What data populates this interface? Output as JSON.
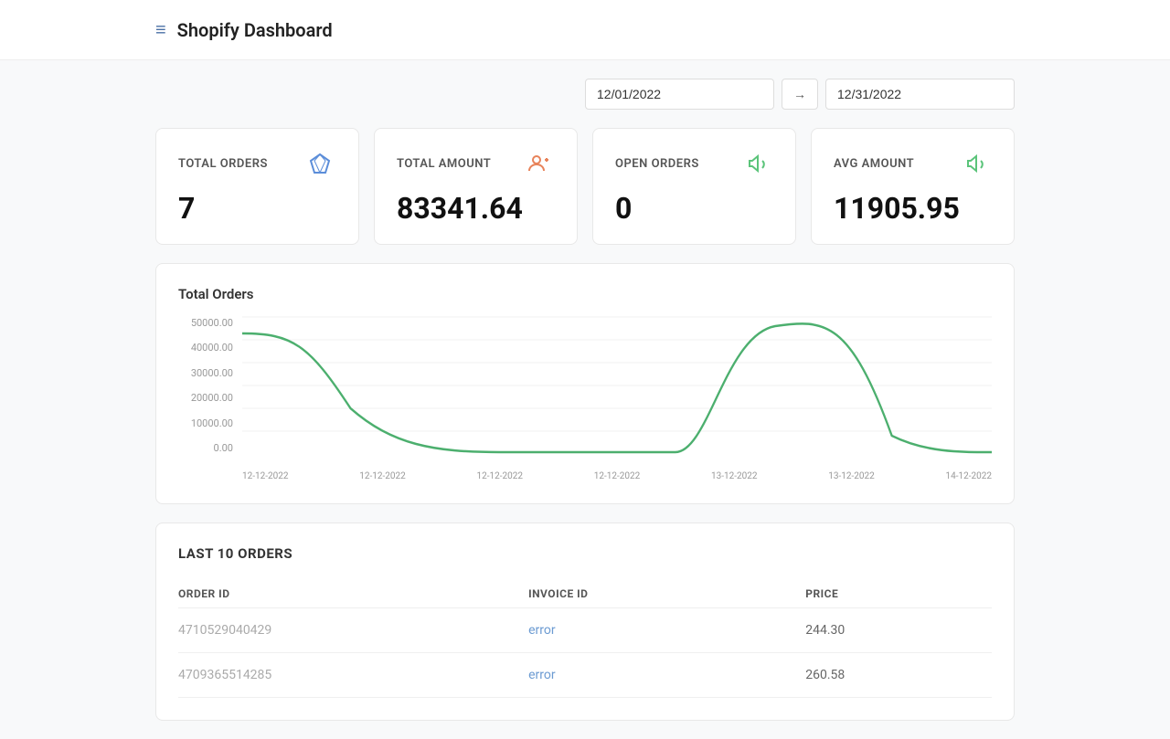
{
  "header": {
    "title": "Shopify Dashboard",
    "icon": "≡"
  },
  "dateFilter": {
    "startDate": "12/01/2022",
    "endDate": "12/31/2022",
    "arrowLabel": "→"
  },
  "stats": [
    {
      "id": "total-orders",
      "label": "TOTAL ORDERS",
      "value": "7",
      "iconName": "diamond-icon",
      "iconSymbol": "💎",
      "iconClass": "icon-diamond"
    },
    {
      "id": "total-amount",
      "label": "TOTAL AMOUNT",
      "value": "83341.64",
      "iconName": "user-add-icon",
      "iconSymbol": "👤",
      "iconClass": "icon-user-add"
    },
    {
      "id": "open-orders",
      "label": "OPEN ORDERS",
      "value": "0",
      "iconName": "megaphone-icon",
      "iconSymbol": "📣",
      "iconClass": "icon-megaphone"
    },
    {
      "id": "avg-amount",
      "label": "AVG AMOUNT",
      "value": "11905.95",
      "iconName": "megaphone2-icon",
      "iconSymbol": "📣",
      "iconClass": "icon-megaphone2"
    }
  ],
  "chart": {
    "title": "Total Orders",
    "yLabels": [
      "50000.00",
      "40000.00",
      "30000.00",
      "20000.00",
      "10000.00",
      "0.00"
    ],
    "xLabels": [
      "12-12-2022",
      "12-12-2022",
      "12-12-2022",
      "12-12-2022",
      "13-12-2022",
      "13-12-2022",
      "14-12-2022"
    ]
  },
  "ordersTable": {
    "title": "LAST 10 ORDERS",
    "columns": [
      "ORDER ID",
      "INVOICE ID",
      "PRICE"
    ],
    "rows": [
      {
        "orderId": "4710529040429",
        "invoiceId": "error",
        "price": "244.30"
      },
      {
        "orderId": "4709365514285",
        "invoiceId": "error",
        "price": "260.58"
      }
    ]
  }
}
